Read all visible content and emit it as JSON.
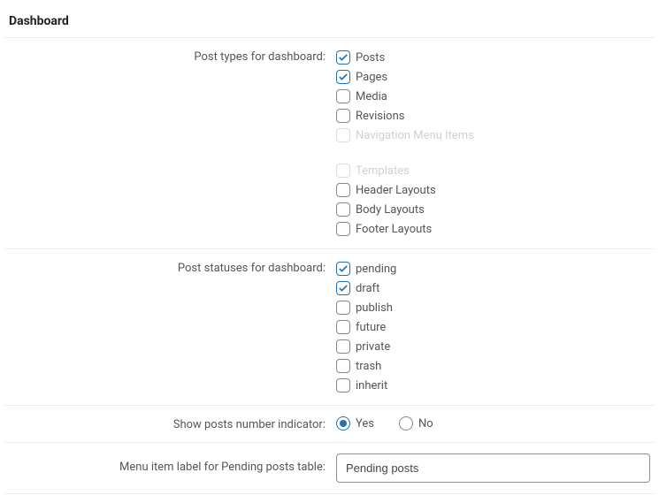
{
  "section_title": "Dashboard",
  "rows": {
    "post_types": {
      "label": "Post types for dashboard:",
      "items": [
        {
          "label": "Posts",
          "checked": true
        },
        {
          "label": "Pages",
          "checked": true
        },
        {
          "label": "Media",
          "checked": false
        },
        {
          "label": "Revisions",
          "checked": false
        },
        {
          "label": "Navigation Menu Items",
          "checked": false,
          "faded": true
        },
        {
          "gap": true
        },
        {
          "label": "Templates",
          "checked": false,
          "faded": true
        },
        {
          "label": "Header Layouts",
          "checked": false
        },
        {
          "label": "Body Layouts",
          "checked": false
        },
        {
          "label": "Footer Layouts",
          "checked": false
        }
      ]
    },
    "post_statuses": {
      "label": "Post statuses for dashboard:",
      "items": [
        {
          "label": "pending",
          "checked": true
        },
        {
          "label": "draft",
          "checked": true
        },
        {
          "label": "publish",
          "checked": false
        },
        {
          "label": "future",
          "checked": false
        },
        {
          "label": "private",
          "checked": false
        },
        {
          "label": "trash",
          "checked": false
        },
        {
          "label": "inherit",
          "checked": false
        }
      ]
    },
    "show_indicator": {
      "label": "Show posts number indicator:",
      "yes": "Yes",
      "no": "No",
      "value": "yes"
    },
    "menu_item_label": {
      "label": "Menu item label for Pending posts table:",
      "value": "Pending posts"
    }
  }
}
